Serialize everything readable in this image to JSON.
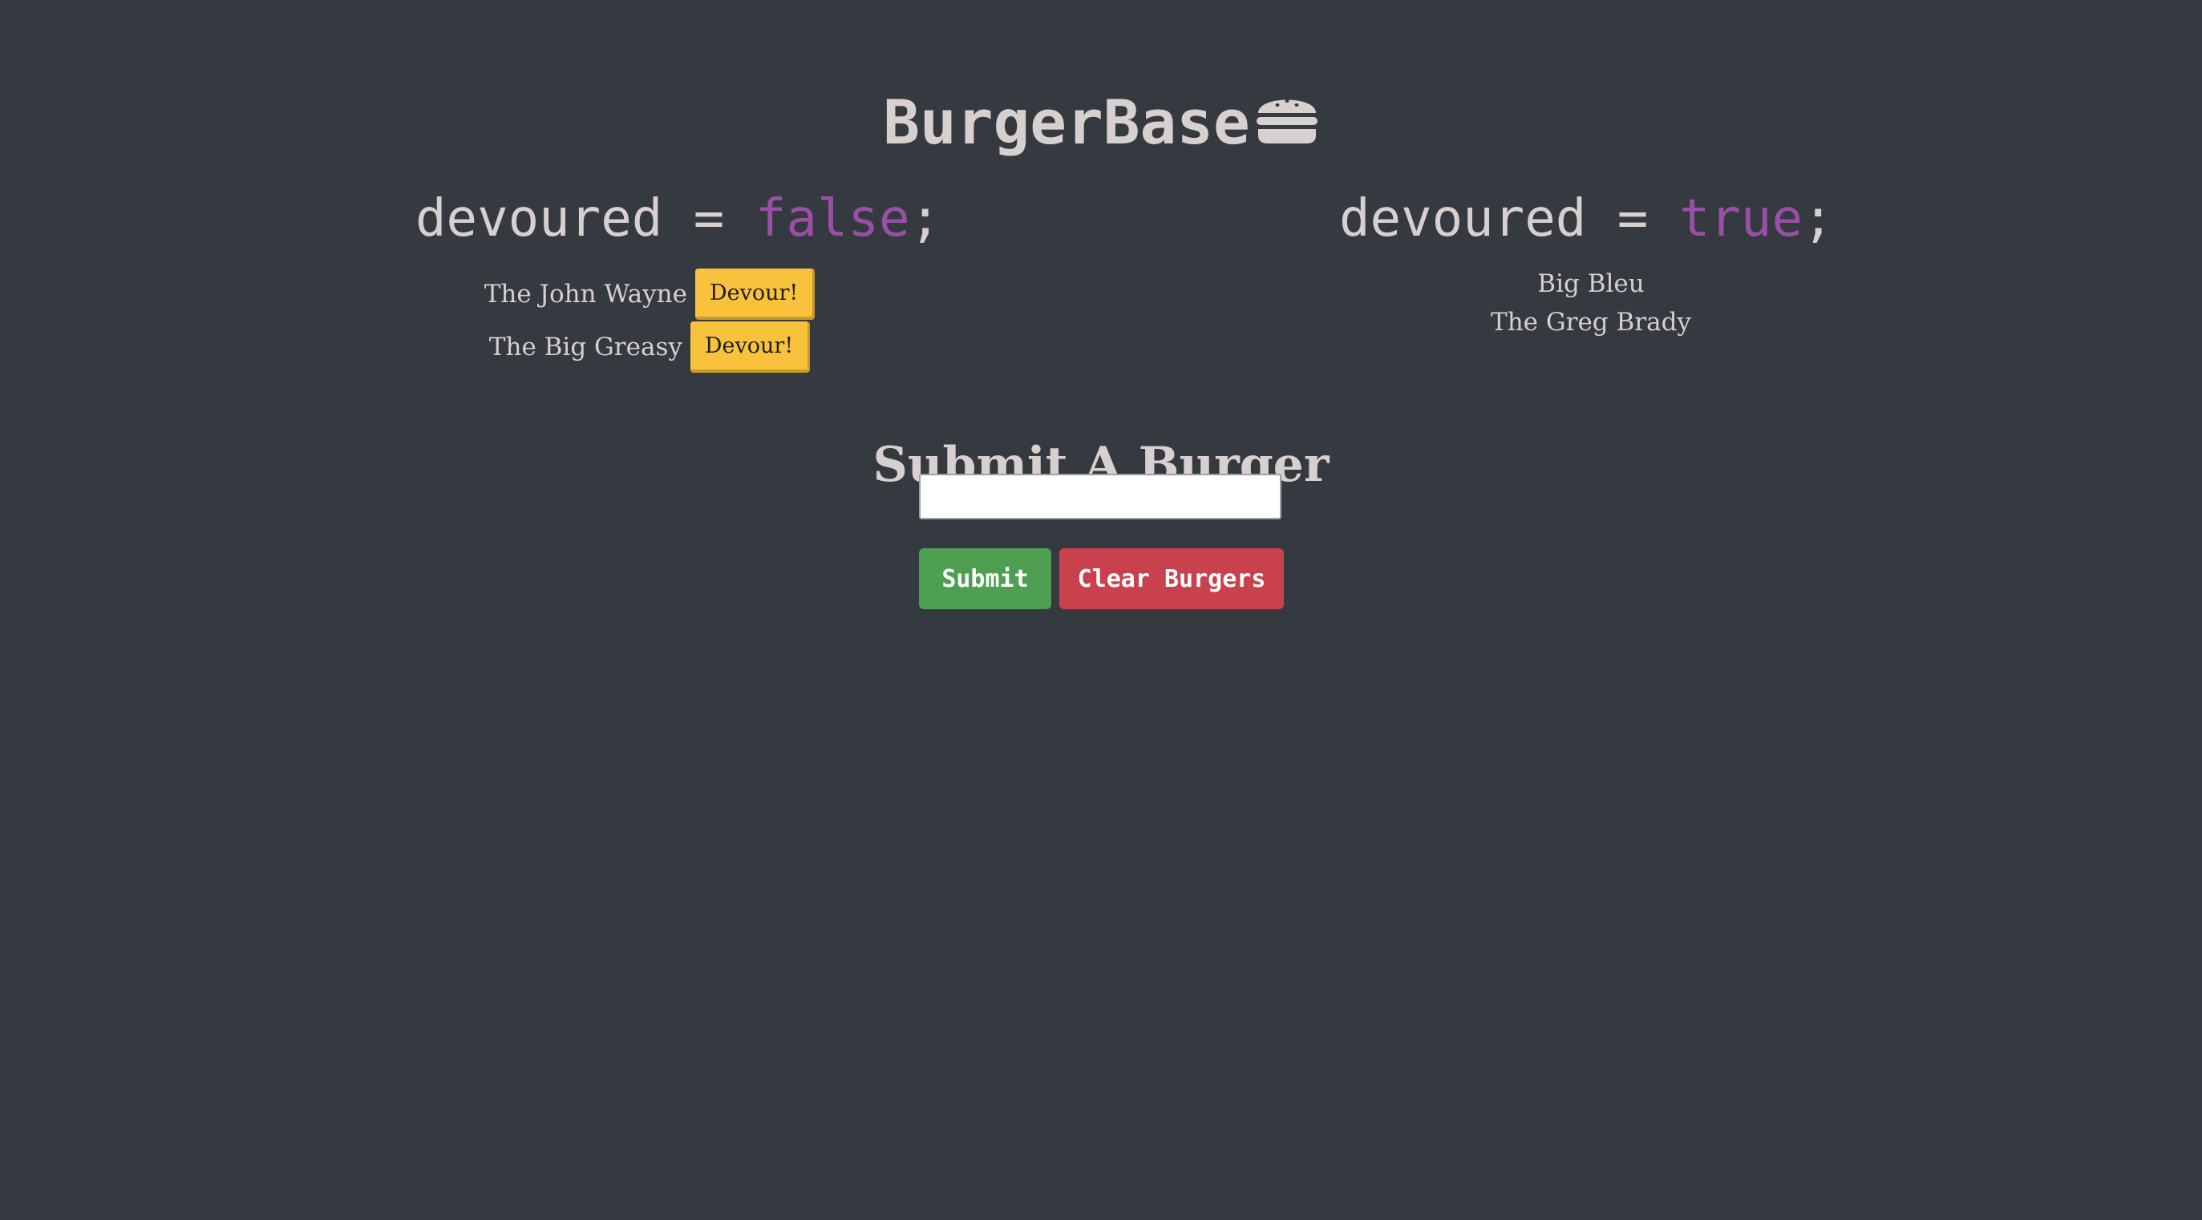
{
  "header": {
    "title": "BurgerBase",
    "icon": "hamburger-icon"
  },
  "left_column": {
    "heading_prefix": "devoured = ",
    "heading_value": "false",
    "heading_suffix": ";",
    "burgers": [
      {
        "name": "The John Wayne",
        "button_label": "Devour!"
      },
      {
        "name": "The Big Greasy",
        "button_label": "Devour!"
      }
    ]
  },
  "right_column": {
    "heading_prefix": "devoured = ",
    "heading_value": "true",
    "heading_suffix": ";",
    "burgers": [
      {
        "name": "Big Bleu"
      },
      {
        "name": "The Greg Brady"
      }
    ]
  },
  "form": {
    "heading": "Submit A Burger",
    "input_value": "",
    "submit_label": "Submit",
    "clear_label": "Clear Burgers"
  },
  "colors": {
    "background": "#353a40",
    "text": "#d7d0cf",
    "boolean_highlight": "#9a4fa6",
    "devour_button": "#f8c23c",
    "submit_button": "#4e9f51",
    "clear_button": "#c9414d"
  }
}
